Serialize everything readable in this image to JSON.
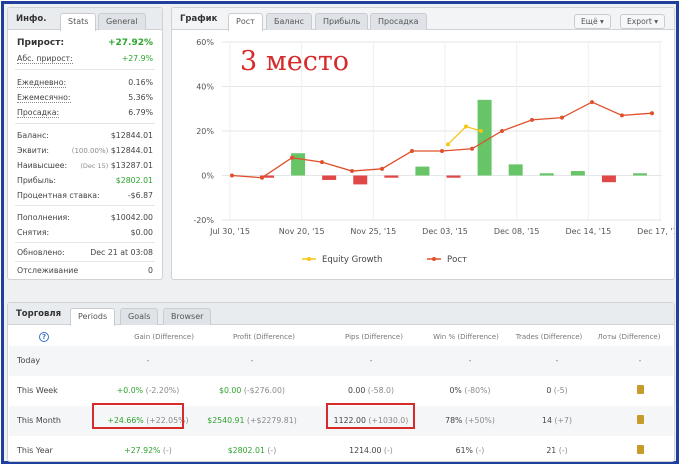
{
  "left": {
    "title": "Инфо.",
    "tabs": [
      "Stats",
      "General"
    ],
    "gain_label": "Прирост:",
    "gain_value": "+27.92%",
    "abs_label": "Абс. прирост:",
    "abs_value": "+27.9%",
    "daily_label": "Ежедневно:",
    "daily_value": "0.16%",
    "monthly_label": "Ежемесячно:",
    "monthly_value": "5.36%",
    "drawdown_label": "Просадка:",
    "drawdown_value": "6.79%",
    "balance_label": "Баланс:",
    "balance_value": "$12844.01",
    "equity_label": "Эквити:",
    "equity_pct": "(100.00%)",
    "equity_value": "$12844.01",
    "highest_label": "Наивысшее:",
    "highest_date": "(Dec 15)",
    "highest_value": "$13287.01",
    "profit_label": "Прибыль:",
    "profit_value": "$2802.01",
    "interest_label": "Процентная ставка:",
    "interest_value": "-$6.87",
    "deposits_label": "Пополнения:",
    "deposits_value": "$10042.00",
    "withdrawals_label": "Снятия:",
    "withdrawals_value": "$0.00",
    "updated_label": "Обновлено:",
    "updated_value": "Dec 21 at 03:08",
    "tracking_label": "Отслеживание",
    "tracking_value": "0"
  },
  "chart_panel": {
    "title": "График",
    "tabs": [
      "Рост",
      "Баланс",
      "Прибыль",
      "Просадка"
    ],
    "more_button": "Ещё",
    "export_button": "Export",
    "overlay_text": "3 место"
  },
  "chart_data": {
    "type": "line",
    "ylim": [
      -20,
      60
    ],
    "y_ticks": [
      "60%",
      "40%",
      "20%",
      "0%",
      "-20%"
    ],
    "x_tick_labels": [
      "Jul 30, '15",
      "Nov 20, '15",
      "Nov 25, '15",
      "Dec 03, '15",
      "Dec 08, '15",
      "Dec 14, '15",
      "Dec 17, '15"
    ],
    "bars": [
      -1,
      10,
      -2,
      -4,
      -1,
      4,
      -1,
      34,
      5,
      1,
      2,
      -3,
      1
    ],
    "series": [
      {
        "name": "Equity Growth",
        "color": "#f5c518",
        "points": [
          [
            7.2,
            14
          ],
          [
            7.8,
            22
          ],
          [
            8.3,
            20
          ]
        ]
      },
      {
        "name": "Рост",
        "color": "#e0502c",
        "points": [
          [
            0,
            0
          ],
          [
            1,
            -1
          ],
          [
            2,
            8
          ],
          [
            3,
            6
          ],
          [
            4,
            2
          ],
          [
            5,
            3
          ],
          [
            6,
            11
          ],
          [
            7,
            11
          ],
          [
            8,
            12
          ],
          [
            9,
            20
          ],
          [
            10,
            25
          ],
          [
            11,
            26
          ],
          [
            12,
            33
          ],
          [
            13,
            27
          ],
          [
            14,
            28
          ]
        ]
      }
    ]
  },
  "bottom": {
    "title": "Торговля",
    "tabs": [
      "Periods",
      "Goals",
      "Browser"
    ],
    "help_icon": "?",
    "headers": [
      "Gain (Difference)",
      "Profit (Difference)",
      "Pips (Difference)",
      "Win % (Difference)",
      "Trades (Difference)",
      "Лоты (Difference)"
    ],
    "rows": [
      {
        "label": "Today",
        "gain": "-",
        "gain_diff": "",
        "profit": "-",
        "profit_diff": "",
        "pips": "-",
        "pips_diff": "",
        "win": "-",
        "win_diff": "",
        "trades": "-",
        "trades_diff": "",
        "lots": "-"
      },
      {
        "label": "This Week",
        "gain": "+0.0%",
        "gain_diff": "(-2.20%)",
        "profit": "$0.00",
        "profit_diff": "(-$276.00)",
        "pips": "0.00",
        "pips_diff": "(-58.0)",
        "win": "0%",
        "win_diff": "(-80%)",
        "trades": "0",
        "trades_diff": "(-5)",
        "lots": ""
      },
      {
        "label": "This Month",
        "gain": "+24.66%",
        "gain_diff": "(+22.05%)",
        "profit": "$2540.91",
        "profit_diff": "(+$2279.81)",
        "pips": "1122.00",
        "pips_diff": "(+1030.0)",
        "win": "78%",
        "win_diff": "(+50%)",
        "trades": "14",
        "trades_diff": "(+7)",
        "lots": ""
      },
      {
        "label": "This Year",
        "gain": "+27.92%",
        "gain_diff": "(-)",
        "profit": "$2802.01",
        "profit_diff": "(-)",
        "pips": "1214.00",
        "pips_diff": "(-)",
        "win": "61%",
        "win_diff": "(-)",
        "trades": "21",
        "trades_diff": "(-)",
        "lots": ""
      }
    ]
  },
  "colors": {
    "green": "#2ea32e",
    "bar_green": "#67c567",
    "bar_red": "#e04848",
    "red_overlay": "#d62b2b",
    "frame": "#1f3f9f"
  }
}
